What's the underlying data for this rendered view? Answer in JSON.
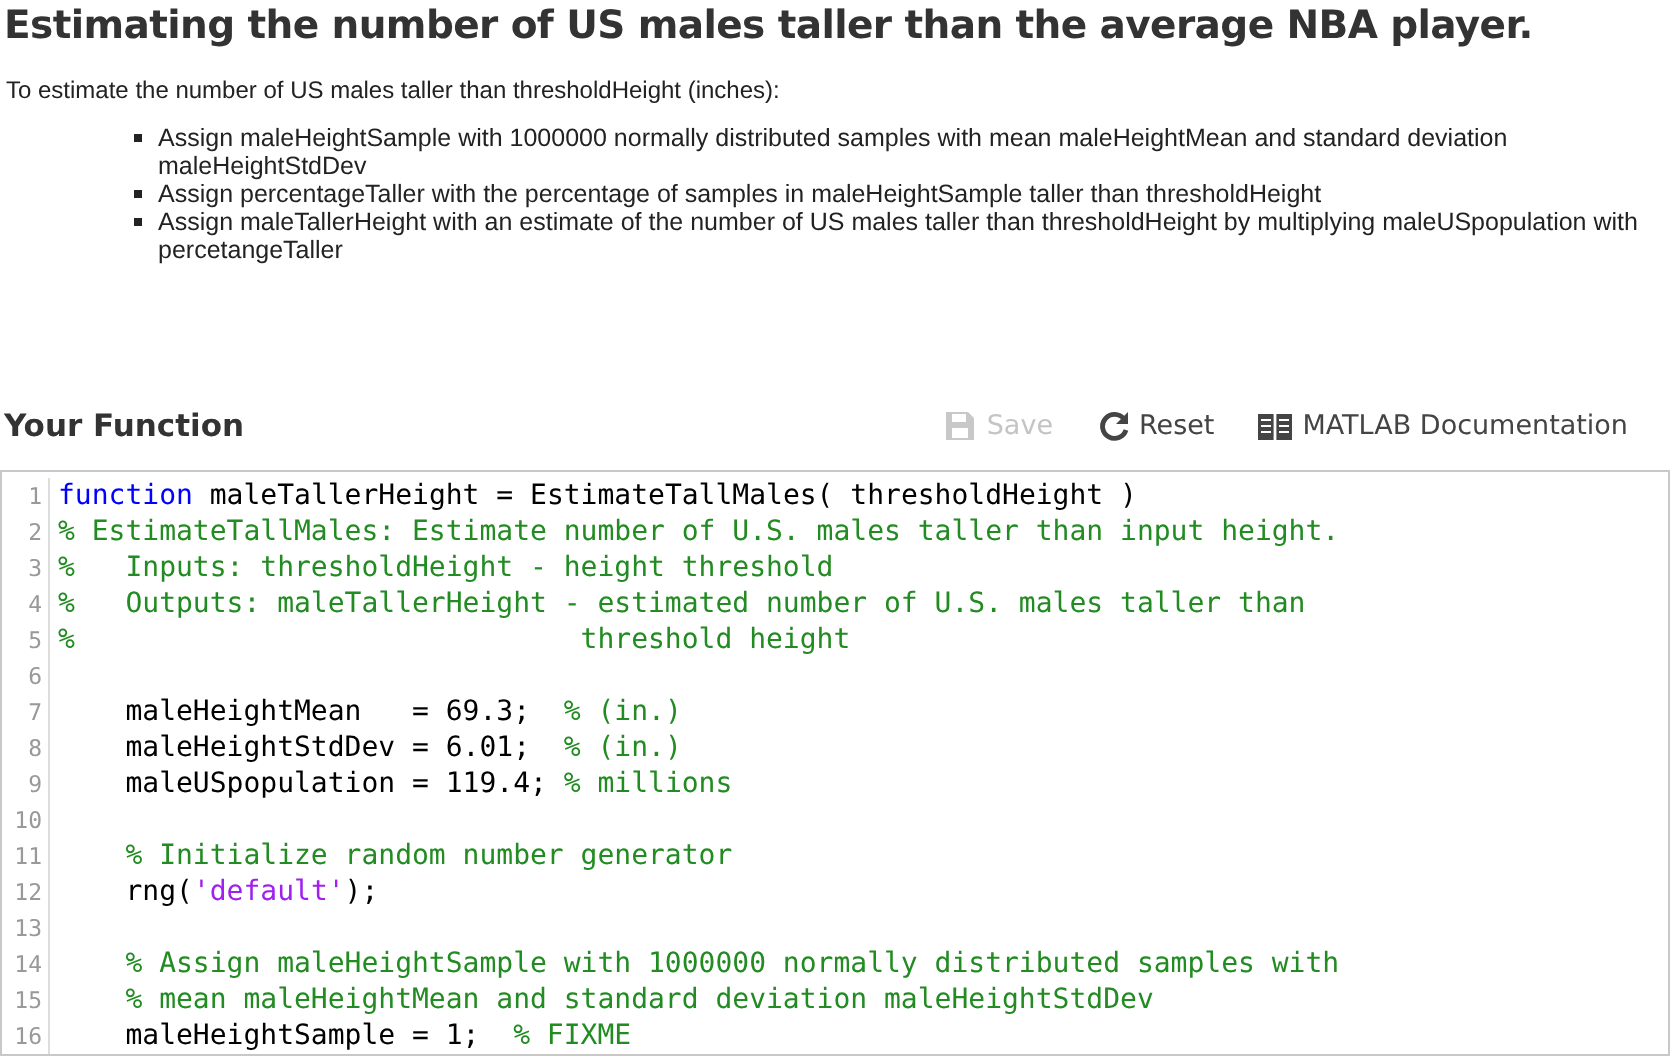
{
  "title": "Estimating the number of US males taller than the average NBA player.",
  "intro": "To estimate the number of US males taller than thresholdHeight (inches):",
  "steps": [
    "Assign maleHeightSample with 1000000 normally distributed samples with mean maleHeightMean and standard deviation maleHeightStdDev",
    "Assign percentageTaller with the percentage of samples in maleHeightSample taller than thresholdHeight",
    "Assign maleTallerHeight with an estimate of the number of US males taller than thresholdHeight by multiplying maleUSpopulation with percetangeTaller"
  ],
  "section_title": "Your Function",
  "toolbar": [
    {
      "kind": "save",
      "label": "Save",
      "disabled": true
    },
    {
      "kind": "reset",
      "label": "Reset",
      "disabled": false
    },
    {
      "kind": "docs",
      "label": "MATLAB Documentation",
      "disabled": false
    }
  ],
  "editor": {
    "lines": [
      {
        "number": "1",
        "tokens": [
          {
            "kind": "keyword",
            "text": "function"
          },
          {
            "kind": "plain",
            "text": " maleTallerHeight = EstimateTallMales( thresholdHeight )"
          }
        ]
      },
      {
        "number": "2",
        "tokens": [
          {
            "kind": "comment",
            "text": "% EstimateTallMales: Estimate number of U.S. males taller than input height."
          }
        ]
      },
      {
        "number": "3",
        "tokens": [
          {
            "kind": "comment",
            "text": "%   Inputs: thresholdHeight - height threshold"
          }
        ]
      },
      {
        "number": "4",
        "tokens": [
          {
            "kind": "comment",
            "text": "%   Outputs: maleTallerHeight - estimated number of U.S. males taller than"
          }
        ]
      },
      {
        "number": "5",
        "tokens": [
          {
            "kind": "comment",
            "text": "%                              threshold height"
          }
        ]
      },
      {
        "number": "6"
      },
      {
        "number": "7",
        "tokens": [
          {
            "kind": "plain",
            "text": "    maleHeightMean   = 69.3;  "
          },
          {
            "kind": "comment",
            "text": "% (in.)"
          }
        ]
      },
      {
        "number": "8",
        "tokens": [
          {
            "kind": "plain",
            "text": "    maleHeightStdDev = 6.01;  "
          },
          {
            "kind": "comment",
            "text": "% (in.)"
          }
        ]
      },
      {
        "number": "9",
        "tokens": [
          {
            "kind": "plain",
            "text": "    maleUSpopulation = 119.4; "
          },
          {
            "kind": "comment",
            "text": "% millions"
          }
        ]
      },
      {
        "number": "10"
      },
      {
        "number": "11",
        "tokens": [
          {
            "kind": "comment",
            "text": "    % Initialize random number generator"
          }
        ]
      },
      {
        "number": "12",
        "tokens": [
          {
            "kind": "plain",
            "text": "    rng("
          },
          {
            "kind": "string",
            "text": "'default'"
          },
          {
            "kind": "plain",
            "text": ");"
          }
        ]
      },
      {
        "number": "13"
      },
      {
        "number": "14",
        "tokens": [
          {
            "kind": "comment",
            "text": "    % Assign maleHeightSample with 1000000 normally distributed samples with"
          }
        ]
      },
      {
        "number": "15",
        "tokens": [
          {
            "kind": "comment",
            "text": "    % mean maleHeightMean and standard deviation maleHeightStdDev"
          }
        ]
      },
      {
        "number": "16",
        "tokens": [
          {
            "kind": "plain",
            "text": "    maleHeightSample = 1;  "
          },
          {
            "kind": "comment",
            "text": "% FIXME"
          }
        ]
      }
    ]
  }
}
